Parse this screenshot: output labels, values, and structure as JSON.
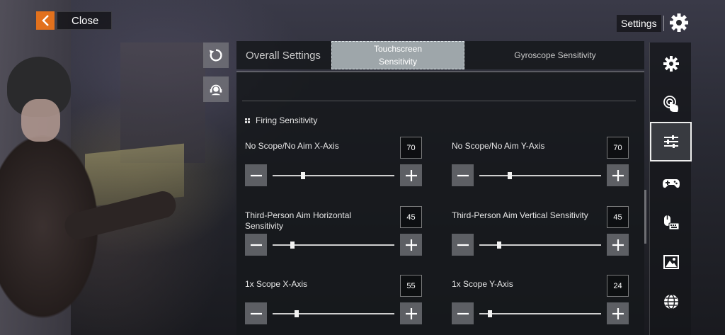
{
  "header": {
    "close_label": "Close",
    "settings_label": "Settings"
  },
  "tabs": [
    {
      "label": "Overall Settings",
      "active": false
    },
    {
      "label": "Touchscreen Sensitivity",
      "active": true
    },
    {
      "label": "Gyroscope Sensitivity",
      "active": false
    }
  ],
  "section": {
    "title": "Firing Sensitivity"
  },
  "sliders": [
    {
      "label": "No Scope/No Aim X-Axis",
      "display": "70",
      "value": 0.25
    },
    {
      "label": "No Scope/No Aim Y-Axis",
      "display": "70",
      "value": 0.25
    },
    {
      "label": "Third-Person Aim Horizontal Sensitivity",
      "display": "45",
      "value": 0.16
    },
    {
      "label": "Third-Person Aim Vertical Sensitivity",
      "display": "45",
      "value": 0.16
    },
    {
      "label": "1x Scope X-Axis",
      "display": "55",
      "value": 0.2
    },
    {
      "label": "1x Scope Y-Axis",
      "display": "24",
      "value": 0.09
    }
  ],
  "rail": [
    {
      "icon": "gear-icon",
      "active": false
    },
    {
      "icon": "touch-icon",
      "active": false
    },
    {
      "icon": "sliders-icon",
      "active": true
    },
    {
      "icon": "gamepad-icon",
      "active": false
    },
    {
      "icon": "mouse-keyboard-icon",
      "active": false
    },
    {
      "icon": "image-icon",
      "active": false
    },
    {
      "icon": "globe-icon",
      "active": false
    }
  ],
  "colors": {
    "accent": "#e2711d",
    "active_tab": "#9ea6aa"
  }
}
